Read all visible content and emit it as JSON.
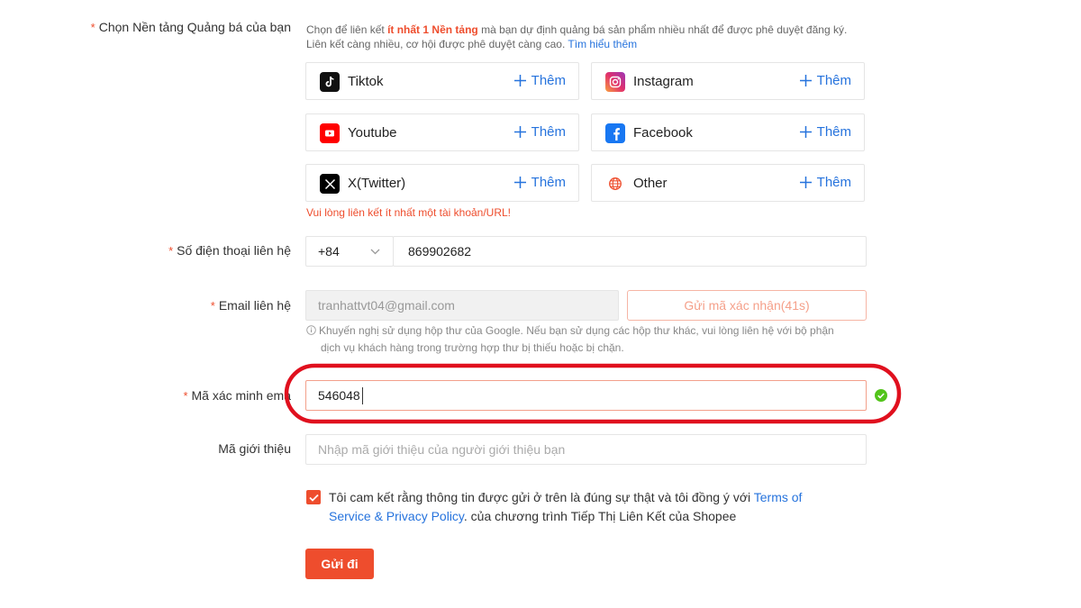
{
  "platforms_section": {
    "label": "Chọn Nền tảng Quảng bá của bạn",
    "desc_part1": "Chọn để liên kết ",
    "desc_highlight": "ít nhất 1 Nền tảng",
    "desc_part2": " mà bạn dự định quảng bá sản phẩm nhiều nhất để được phê duyệt đăng ký.",
    "desc_line2": "Liên kết càng nhiều, cơ hội được phê duyệt càng cao. ",
    "learn_more": "Tìm hiểu thêm",
    "add_label": "Thêm",
    "items": [
      {
        "name": "Tiktok",
        "icon": "tiktok-icon"
      },
      {
        "name": "Instagram",
        "icon": "instagram-icon"
      },
      {
        "name": "Youtube",
        "icon": "youtube-icon"
      },
      {
        "name": "Facebook",
        "icon": "facebook-icon"
      },
      {
        "name": "X(Twitter)",
        "icon": "x-twitter-icon"
      },
      {
        "name": "Other",
        "icon": "globe-icon"
      }
    ],
    "error": "Vui lòng liên kết ít nhất một tài khoản/URL!"
  },
  "phone": {
    "label": "Số điện thoại liên hệ",
    "country_code": "+84",
    "value": "869902682"
  },
  "email": {
    "label": "Email liên hệ",
    "value": "tranhattvt04@gmail.com",
    "send_code": "Gửi mã xác nhận(41s)",
    "hint_line1": "Khuyến nghị sử dụng hộp thư của Google. Nếu bạn sử dụng các hộp thư khác, vui lòng liên hệ với bộ phận",
    "hint_line2": "dịch vụ khách hàng trong trường hợp thư bị thiếu hoặc bị chặn."
  },
  "verify": {
    "label": "Mã xác minh ema",
    "value": "546048"
  },
  "referral": {
    "label": "Mã giới thiệu",
    "placeholder": "Nhập mã giới thiệu của người giới thiệu bạn"
  },
  "agreement": {
    "text1": "Tôi cam kết rằng thông tin được gửi ở trên là đúng sự thật và tôi đồng ý với ",
    "link_part1": "Terms of",
    "link_part2": "Service & Privacy Policy",
    "text2": ". của chương trình Tiếp Thị Liên Kết của Shopee",
    "checked": true
  },
  "submit_label": "Gửi đi",
  "colors": {
    "accent": "#ee4d2d",
    "link": "#2673dd",
    "highlight_ring": "#e0101e",
    "success": "#52c41a"
  }
}
